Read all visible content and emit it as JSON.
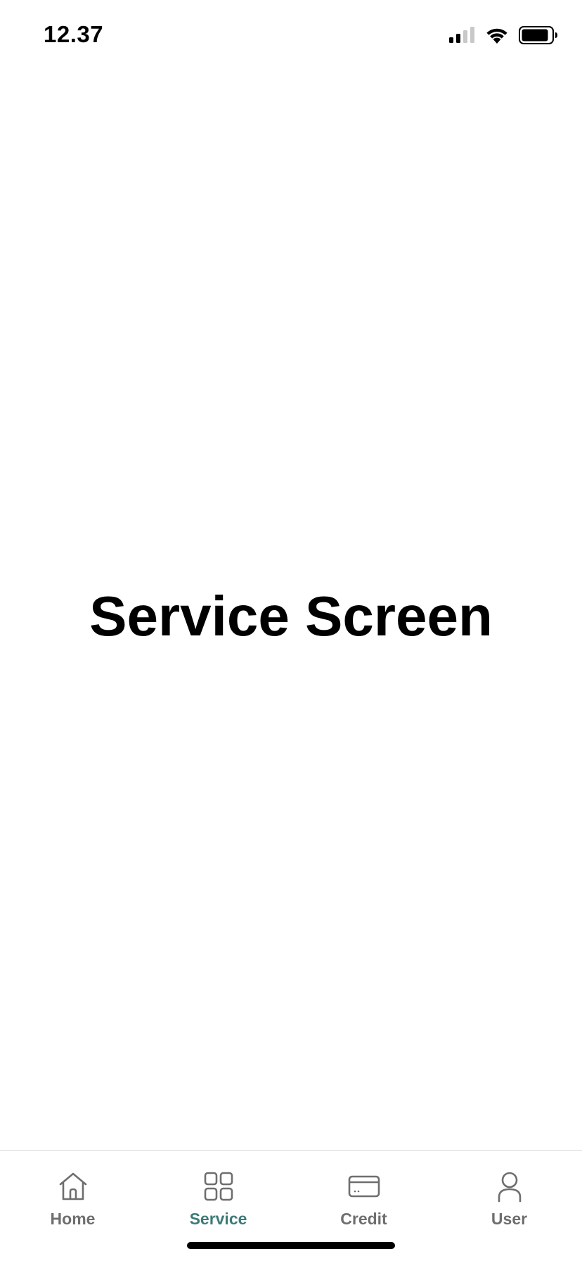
{
  "status_bar": {
    "time": "12.37",
    "icons": [
      "signal-icon",
      "wifi-icon",
      "battery-icon"
    ]
  },
  "main": {
    "title": "Service Screen"
  },
  "tab_bar": {
    "active_tab": "Service",
    "colors": {
      "active": "#3e7a77",
      "inactive": "#6e6e6e"
    },
    "tabs": [
      {
        "label": "Home",
        "icon": "home-icon"
      },
      {
        "label": "Service",
        "icon": "grid-icon"
      },
      {
        "label": "Credit",
        "icon": "credit-card-icon"
      },
      {
        "label": "User",
        "icon": "user-icon"
      }
    ]
  }
}
